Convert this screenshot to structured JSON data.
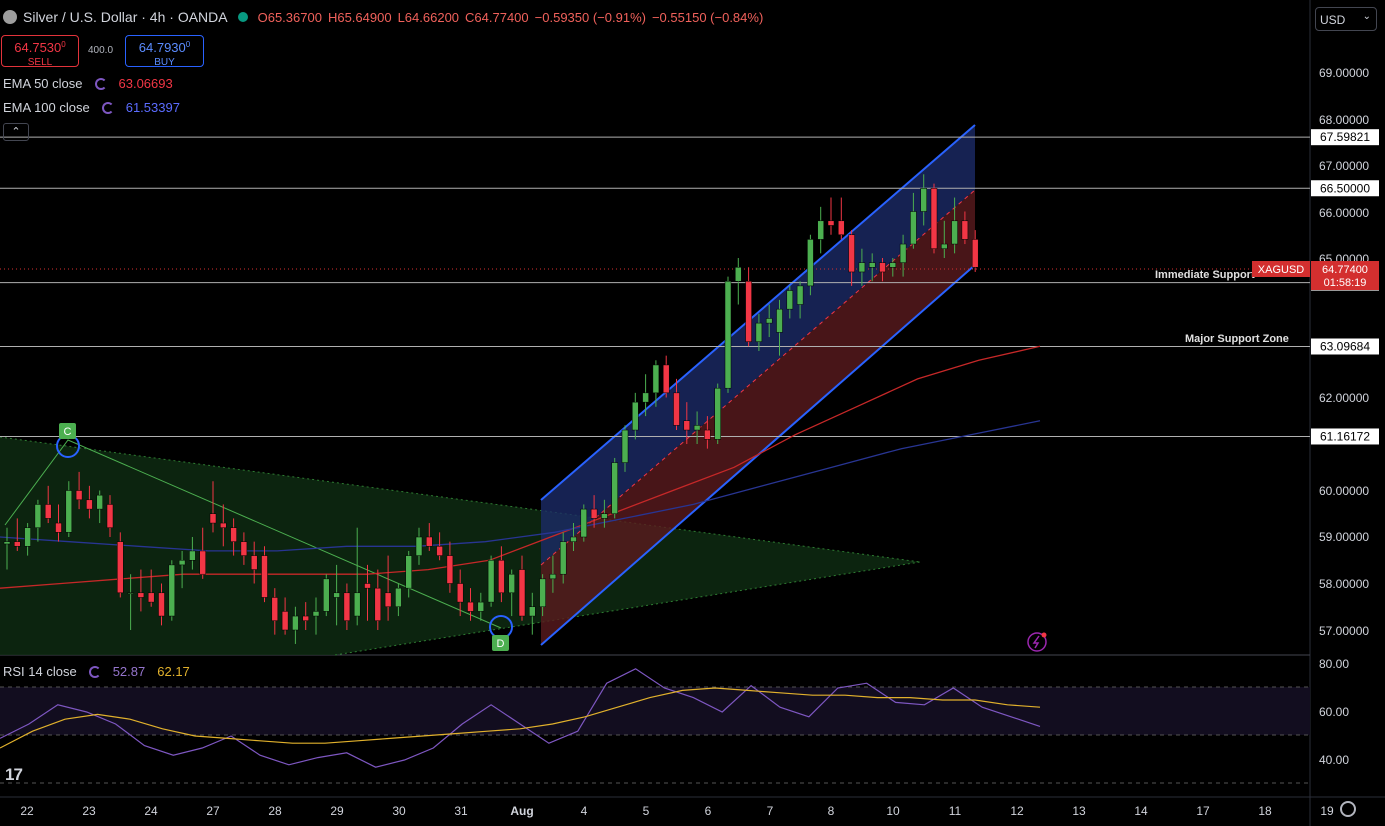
{
  "header": {
    "symbol_title": "Silver / U.S. Dollar · 4h · OANDA",
    "open": "O65.36700",
    "high": "H65.64900",
    "low": "L64.66200",
    "close": "C64.77400",
    "change": "−0.59350 (−0.91%)",
    "change2": "−0.55150 (−0.84%)"
  },
  "trade": {
    "sell_price": "64.7530",
    "sell_sup": "0",
    "sell_label": "SELL",
    "spread": "400.0",
    "buy_price": "64.7930",
    "buy_sup": "0",
    "buy_label": "BUY"
  },
  "indicators": {
    "ema50_label": "EMA 50 close",
    "ema50_value": "63.06693",
    "ema100_label": "EMA 100 close",
    "ema100_value": "61.53397",
    "rsi_label": "RSI 14 close",
    "rsi_value": "52.87",
    "rsi_ma_value": "62.17"
  },
  "currency": "USD",
  "colors": {
    "up": "#26a69a",
    "up_candle": "#4caf50",
    "down": "#f23645",
    "ema50": "#c62828",
    "ema100": "#283593",
    "rsi": "#7e57c2",
    "rsi_ma": "#e1b12c",
    "channel_upper": "#1c2b66",
    "channel_lower": "#5a1a1e",
    "channel_line": "#2962ff",
    "triangle": "#0e2a12"
  },
  "annotations": {
    "immediate_support": "Immediate Support",
    "major_support": "Major Support Zone",
    "point_c": "C",
    "point_d": "D"
  },
  "price_axis": {
    "labels": [
      "69.00000",
      "68.00000",
      "67.00000",
      "66.00000",
      "65.00000",
      "62.00000",
      "60.00000",
      "59.00000",
      "58.00000",
      "57.00000"
    ],
    "levels": [
      "67.59821",
      "66.50000",
      "64.47099",
      "63.09684",
      "61.16172"
    ],
    "current_symbol": "XAGUSD",
    "current_price": "64.77400",
    "countdown": "01:58:19"
  },
  "rsi_axis": [
    "80.00",
    "60.00",
    "40.00"
  ],
  "time_axis": [
    "22",
    "23",
    "24",
    "27",
    "28",
    "29",
    "30",
    "31",
    "Aug",
    "4",
    "5",
    "6",
    "7",
    "8",
    "10",
    "11",
    "12",
    "13",
    "14",
    "17",
    "18",
    "19"
  ],
  "chart_data": {
    "type": "candlestick",
    "title": "Silver / U.S. Dollar · 4h · OANDA",
    "ylim": [
      56.6,
      69.6
    ],
    "horizontal_levels": [
      67.59821,
      66.5,
      64.47099,
      63.09684,
      61.16172
    ],
    "candles": [
      {
        "o": 58.85,
        "h": 59.2,
        "l": 58.3,
        "c": 58.9
      },
      {
        "o": 58.9,
        "h": 59.4,
        "l": 58.7,
        "c": 58.8
      },
      {
        "o": 58.8,
        "h": 59.3,
        "l": 58.6,
        "c": 59.2
      },
      {
        "o": 59.2,
        "h": 59.8,
        "l": 58.9,
        "c": 59.7
      },
      {
        "o": 59.7,
        "h": 60.1,
        "l": 59.3,
        "c": 59.4
      },
      {
        "o": 59.3,
        "h": 59.7,
        "l": 58.9,
        "c": 59.1
      },
      {
        "o": 59.1,
        "h": 60.2,
        "l": 59.0,
        "c": 60.0
      },
      {
        "o": 60.0,
        "h": 60.4,
        "l": 59.6,
        "c": 59.8
      },
      {
        "o": 59.8,
        "h": 60.1,
        "l": 59.4,
        "c": 59.6
      },
      {
        "o": 59.6,
        "h": 60.0,
        "l": 59.3,
        "c": 59.9
      },
      {
        "o": 59.7,
        "h": 59.9,
        "l": 59.0,
        "c": 59.2
      },
      {
        "o": 58.9,
        "h": 59.1,
        "l": 57.7,
        "c": 57.8
      },
      {
        "o": 57.8,
        "h": 58.2,
        "l": 57.0,
        "c": 57.8
      },
      {
        "o": 57.8,
        "h": 58.3,
        "l": 57.4,
        "c": 57.7
      },
      {
        "o": 57.8,
        "h": 58.3,
        "l": 57.5,
        "c": 57.6
      },
      {
        "o": 57.8,
        "h": 58.0,
        "l": 57.1,
        "c": 57.3
      },
      {
        "o": 57.3,
        "h": 58.5,
        "l": 57.2,
        "c": 58.4
      },
      {
        "o": 58.4,
        "h": 58.7,
        "l": 57.9,
        "c": 58.5
      },
      {
        "o": 58.5,
        "h": 59.0,
        "l": 58.3,
        "c": 58.7
      },
      {
        "o": 58.7,
        "h": 59.2,
        "l": 58.1,
        "c": 58.2
      },
      {
        "o": 59.5,
        "h": 60.2,
        "l": 59.1,
        "c": 59.3
      },
      {
        "o": 59.3,
        "h": 59.7,
        "l": 58.8,
        "c": 59.2
      },
      {
        "o": 59.2,
        "h": 59.4,
        "l": 58.6,
        "c": 58.9
      },
      {
        "o": 58.9,
        "h": 59.1,
        "l": 58.4,
        "c": 58.6
      },
      {
        "o": 58.6,
        "h": 58.9,
        "l": 58.0,
        "c": 58.3
      },
      {
        "o": 58.6,
        "h": 58.8,
        "l": 57.6,
        "c": 57.7
      },
      {
        "o": 57.7,
        "h": 57.9,
        "l": 56.9,
        "c": 57.2
      },
      {
        "o": 57.4,
        "h": 57.7,
        "l": 56.9,
        "c": 57.0
      },
      {
        "o": 57.0,
        "h": 57.5,
        "l": 56.7,
        "c": 57.3
      },
      {
        "o": 57.3,
        "h": 57.6,
        "l": 57.0,
        "c": 57.2
      },
      {
        "o": 57.3,
        "h": 57.7,
        "l": 56.9,
        "c": 57.4
      },
      {
        "o": 57.4,
        "h": 58.2,
        "l": 57.3,
        "c": 58.1
      },
      {
        "o": 57.7,
        "h": 58.4,
        "l": 57.1,
        "c": 57.8
      },
      {
        "o": 57.8,
        "h": 58.0,
        "l": 57.0,
        "c": 57.2
      },
      {
        "o": 57.3,
        "h": 59.2,
        "l": 57.1,
        "c": 57.8
      },
      {
        "o": 58.0,
        "h": 58.4,
        "l": 57.2,
        "c": 57.9
      },
      {
        "o": 57.9,
        "h": 58.3,
        "l": 57.0,
        "c": 57.2
      },
      {
        "o": 57.8,
        "h": 58.6,
        "l": 57.2,
        "c": 57.5
      },
      {
        "o": 57.5,
        "h": 58.0,
        "l": 57.3,
        "c": 57.9
      },
      {
        "o": 57.9,
        "h": 58.7,
        "l": 57.7,
        "c": 58.6
      },
      {
        "o": 58.6,
        "h": 59.2,
        "l": 58.4,
        "c": 59.0
      },
      {
        "o": 59.0,
        "h": 59.3,
        "l": 58.7,
        "c": 58.8
      },
      {
        "o": 58.8,
        "h": 59.1,
        "l": 58.5,
        "c": 58.6
      },
      {
        "o": 58.6,
        "h": 58.9,
        "l": 57.8,
        "c": 58.0
      },
      {
        "o": 58.0,
        "h": 58.3,
        "l": 57.3,
        "c": 57.6
      },
      {
        "o": 57.6,
        "h": 57.9,
        "l": 57.2,
        "c": 57.4
      },
      {
        "o": 57.4,
        "h": 57.8,
        "l": 57.2,
        "c": 57.6
      },
      {
        "o": 57.6,
        "h": 58.6,
        "l": 57.5,
        "c": 58.5
      },
      {
        "o": 58.5,
        "h": 58.8,
        "l": 57.6,
        "c": 57.8
      },
      {
        "o": 57.8,
        "h": 58.3,
        "l": 57.3,
        "c": 58.2
      },
      {
        "o": 58.3,
        "h": 58.6,
        "l": 57.2,
        "c": 57.3
      },
      {
        "o": 57.3,
        "h": 57.8,
        "l": 56.9,
        "c": 57.5
      },
      {
        "o": 57.5,
        "h": 58.2,
        "l": 57.3,
        "c": 58.1
      },
      {
        "o": 58.1,
        "h": 58.6,
        "l": 57.8,
        "c": 58.2
      },
      {
        "o": 58.2,
        "h": 59.1,
        "l": 58.0,
        "c": 58.9
      },
      {
        "o": 58.9,
        "h": 59.3,
        "l": 58.7,
        "c": 59.0
      },
      {
        "o": 59.0,
        "h": 59.7,
        "l": 58.9,
        "c": 59.6
      },
      {
        "o": 59.6,
        "h": 59.9,
        "l": 59.2,
        "c": 59.4
      },
      {
        "o": 59.4,
        "h": 59.8,
        "l": 59.2,
        "c": 59.5
      },
      {
        "o": 59.5,
        "h": 60.7,
        "l": 59.4,
        "c": 60.6
      },
      {
        "o": 60.6,
        "h": 61.4,
        "l": 60.4,
        "c": 61.3
      },
      {
        "o": 61.3,
        "h": 62.1,
        "l": 61.1,
        "c": 61.9
      },
      {
        "o": 61.9,
        "h": 62.5,
        "l": 61.6,
        "c": 62.1
      },
      {
        "o": 62.1,
        "h": 62.8,
        "l": 61.8,
        "c": 62.7
      },
      {
        "o": 62.7,
        "h": 62.9,
        "l": 62.0,
        "c": 62.1
      },
      {
        "o": 62.1,
        "h": 62.4,
        "l": 61.3,
        "c": 61.4
      },
      {
        "o": 61.5,
        "h": 61.9,
        "l": 61.0,
        "c": 61.3
      },
      {
        "o": 61.3,
        "h": 61.7,
        "l": 61.0,
        "c": 61.4
      },
      {
        "o": 61.3,
        "h": 61.6,
        "l": 60.9,
        "c": 61.1
      },
      {
        "o": 61.1,
        "h": 62.3,
        "l": 61.0,
        "c": 62.2
      },
      {
        "o": 62.2,
        "h": 64.6,
        "l": 62.1,
        "c": 64.5
      },
      {
        "o": 64.5,
        "h": 65.0,
        "l": 64.0,
        "c": 64.8
      },
      {
        "o": 64.5,
        "h": 64.8,
        "l": 63.1,
        "c": 63.2
      },
      {
        "o": 63.2,
        "h": 63.8,
        "l": 63.0,
        "c": 63.6
      },
      {
        "o": 63.6,
        "h": 64.0,
        "l": 63.3,
        "c": 63.7
      },
      {
        "o": 63.4,
        "h": 64.1,
        "l": 62.9,
        "c": 63.9
      },
      {
        "o": 63.9,
        "h": 64.4,
        "l": 63.7,
        "c": 64.3
      },
      {
        "o": 64.0,
        "h": 64.5,
        "l": 63.7,
        "c": 64.4
      },
      {
        "o": 64.4,
        "h": 65.5,
        "l": 64.2,
        "c": 65.4
      },
      {
        "o": 65.4,
        "h": 66.1,
        "l": 65.1,
        "c": 65.8
      },
      {
        "o": 65.8,
        "h": 66.3,
        "l": 65.5,
        "c": 65.7
      },
      {
        "o": 65.8,
        "h": 66.3,
        "l": 65.4,
        "c": 65.5
      },
      {
        "o": 65.5,
        "h": 65.6,
        "l": 64.4,
        "c": 64.7
      },
      {
        "o": 64.7,
        "h": 65.2,
        "l": 64.4,
        "c": 64.9
      },
      {
        "o": 64.8,
        "h": 65.1,
        "l": 64.5,
        "c": 64.9
      },
      {
        "o": 64.9,
        "h": 65.0,
        "l": 64.5,
        "c": 64.7
      },
      {
        "o": 64.8,
        "h": 65.0,
        "l": 64.6,
        "c": 64.9
      },
      {
        "o": 64.9,
        "h": 65.5,
        "l": 64.6,
        "c": 65.3
      },
      {
        "o": 65.3,
        "h": 66.4,
        "l": 65.2,
        "c": 66.0
      },
      {
        "o": 66.0,
        "h": 66.8,
        "l": 65.7,
        "c": 66.5
      },
      {
        "o": 66.5,
        "h": 66.6,
        "l": 65.1,
        "c": 65.2
      },
      {
        "o": 65.2,
        "h": 65.8,
        "l": 65.0,
        "c": 65.3
      },
      {
        "o": 65.3,
        "h": 66.3,
        "l": 65.1,
        "c": 65.8
      },
      {
        "o": 65.8,
        "h": 66.0,
        "l": 65.3,
        "c": 65.4
      },
      {
        "o": 65.4,
        "h": 65.6,
        "l": 64.7,
        "c": 64.8
      }
    ],
    "ema50": [
      57.9,
      58.0,
      58.1,
      58.2,
      58.2,
      58.2,
      58.2,
      58.3,
      58.5,
      59.0,
      59.5,
      60.0,
      60.5,
      61.2,
      61.8,
      62.4,
      62.8,
      63.1
    ],
    "ema100": [
      59.0,
      58.9,
      58.8,
      58.7,
      58.7,
      58.8,
      58.8,
      58.9,
      59.1,
      59.4,
      59.7,
      60.1,
      60.5,
      60.9,
      61.2,
      61.5
    ],
    "rsi": [
      49,
      55,
      63,
      60,
      55,
      46,
      42,
      45,
      50,
      42,
      38,
      41,
      43,
      37,
      40,
      45,
      55,
      63,
      55,
      47,
      52,
      72,
      78,
      70,
      66,
      60,
      71,
      62,
      58,
      70,
      72,
      64,
      63,
      70,
      62,
      58,
      54
    ],
    "rsi_ma": [
      45,
      52,
      57,
      59,
      57,
      53,
      50,
      49,
      48,
      47,
      47,
      48,
      49,
      50,
      51,
      52,
      53,
      55,
      58,
      62,
      66,
      69,
      70,
      69,
      68,
      67,
      67,
      66,
      66,
      65,
      65,
      63,
      62
    ]
  }
}
